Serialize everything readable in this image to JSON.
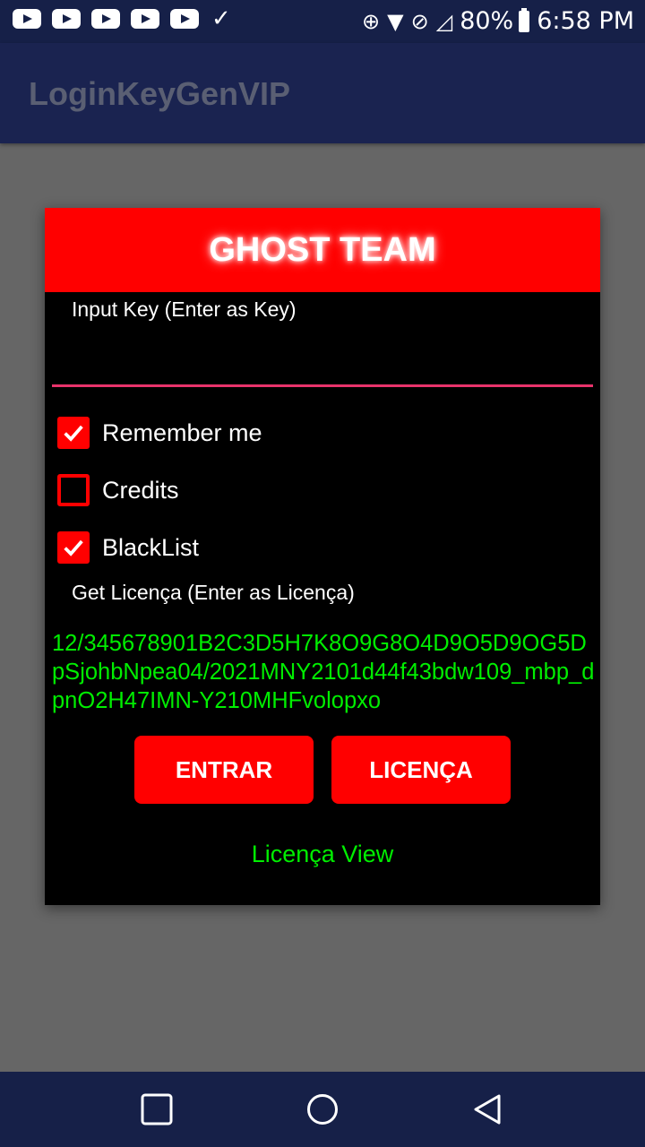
{
  "status_bar": {
    "battery": "80%",
    "time": "6:58 PM"
  },
  "app_bar": {
    "title": "LoginKeyGenVIP"
  },
  "dialog": {
    "title": "GHOST TEAM",
    "input_label": "Input Key (Enter as Key)",
    "input_value": "",
    "checkboxes": [
      {
        "label": "Remember me",
        "checked": true
      },
      {
        "label": "Credits",
        "checked": false
      },
      {
        "label": "BlackList",
        "checked": true
      }
    ],
    "licenca_label": "Get Licença (Enter as Licença)",
    "licenca_value": "12/345678901B2C3D5H7K8O9G8O4D9O5D9OG5DpSjohbNpea04/2021MNY2101d44f43bdw109_mbp_dpnO2H47IMN-Y210MHFvolopxo",
    "entrar_label": "ENTRAR",
    "licenca_button_label": "LICENÇA",
    "licenca_view_label": "Licença View"
  },
  "colors": {
    "accent": "#ff0000",
    "text_green": "#00ee00",
    "underline": "#e8336b",
    "bar": "#162048"
  }
}
